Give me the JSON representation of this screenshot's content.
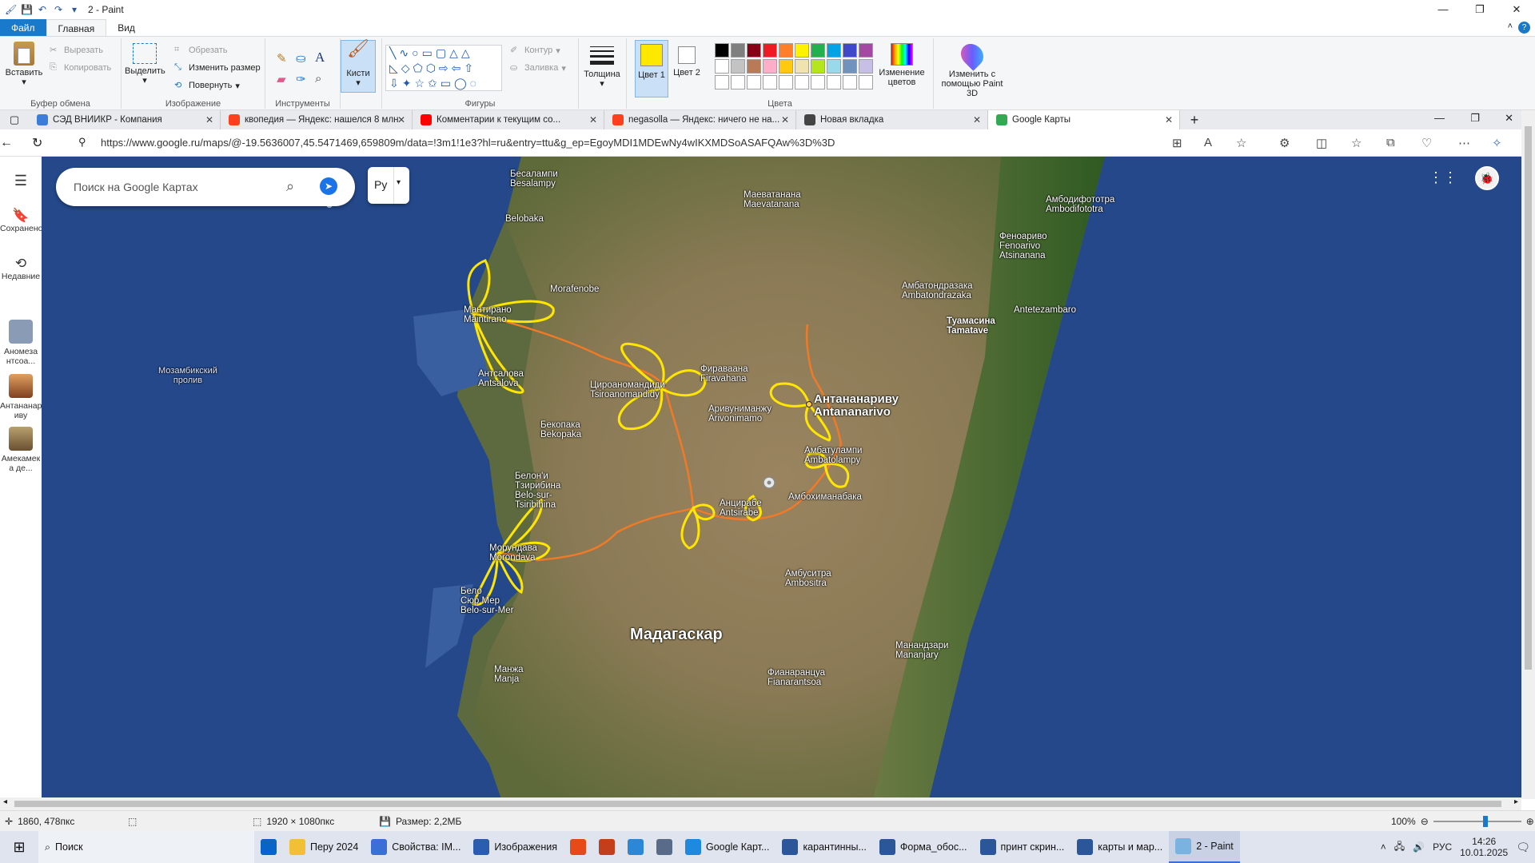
{
  "window": {
    "title": "2 - Paint",
    "controls": [
      "—",
      "❐",
      "✕"
    ]
  },
  "ribbon_tabs": [
    "Файл",
    "Главная",
    "Вид"
  ],
  "ribbon": {
    "clipboard": {
      "paste": "Вставить",
      "cut": "Вырезать",
      "copy": "Копировать",
      "label": "Буфер обмена"
    },
    "image": {
      "select": "Выделить",
      "crop": "Обрезать",
      "resize": "Изменить размер",
      "rotate": "Повернуть",
      "label": "Изображение"
    },
    "tools": {
      "label": "Инструменты"
    },
    "brushes": {
      "label": "Кисти"
    },
    "shapes": {
      "outline": "Контур",
      "fill": "Заливка",
      "label": "Фигуры"
    },
    "size": {
      "label": "Толщина"
    },
    "colors": {
      "color1": "Цвет 1",
      "color2": "Цвет 2",
      "edit": "Изменение цветов",
      "label": "Цвета",
      "color1_value": "#ffe800",
      "color2_value": "#ffffff",
      "palette_row1": [
        "#000000",
        "#7f7f7f",
        "#880015",
        "#ed1c24",
        "#ff7f27",
        "#fff200",
        "#22b14c",
        "#00a2e8",
        "#3f48cc",
        "#a349a4"
      ],
      "palette_row2": [
        "#ffffff",
        "#c3c3c3",
        "#b97a57",
        "#ffaec9",
        "#ffc90e",
        "#efe4b0",
        "#b5e61d",
        "#99d9ea",
        "#7092be",
        "#c8bfe7"
      ]
    },
    "paint3d": "Изменить с помощью Paint 3D"
  },
  "browser": {
    "tabs": [
      {
        "label": "СЭД ВНИИКР - Компания",
        "fav_color": "#3b7dd8"
      },
      {
        "label": "квопедия — Яндекс: нашелся 8 млн",
        "fav_color": "#fc3f1d"
      },
      {
        "label": "Комментарии к текущим со...",
        "fav_color": "#ff0000"
      },
      {
        "label": "negasolla — Яндекс: ничего не на...",
        "fav_color": "#fc3f1d"
      },
      {
        "label": "Новая вкладка",
        "fav_color": "#444444"
      },
      {
        "label": "Google Карты",
        "fav_color": "#34a853"
      }
    ],
    "url": "https://www.google.ru/maps/@-19.5636007,45.5471469,659809m/data=!3m1!1e3?hl=ru&entry=ttu&g_ep=EgoyMDI1MDEwNy4wIKXMDSoASAFQAw%3D%3D"
  },
  "maps": {
    "search_placeholder": "Поиск на Google Картах",
    "layer_label": "Ру",
    "rail": [
      {
        "label": "Сохранено"
      },
      {
        "label": "Недавние"
      },
      {
        "label": "Аномеза нтсоа..."
      },
      {
        "label": "Антананар иву"
      },
      {
        "label": "Амекамек а де..."
      }
    ],
    "labels": [
      {
        "text": "Бесалампи\nBesalampy",
        "cls": ""
      },
      {
        "text": "Маеватанана\nMaevatanana",
        "cls": ""
      },
      {
        "text": "Амбодифототра\nAmbodifototra",
        "cls": ""
      },
      {
        "text": "Belobaka",
        "cls": ""
      },
      {
        "text": "Феноариво\nFenoarivo\nAtsinanana",
        "cls": ""
      },
      {
        "text": "Morafenobe",
        "cls": ""
      },
      {
        "text": "Амбатондразака\nAmbatondrazaka",
        "cls": ""
      },
      {
        "text": "Мантирано\nMaintirano",
        "cls": ""
      },
      {
        "text": "Antetezambaro",
        "cls": ""
      },
      {
        "text": "Туамасина\nTamatave",
        "cls": "big-ish"
      },
      {
        "text": "Мозамбикский\nпролив",
        "cls": "sea"
      },
      {
        "text": "Антсалова\nAntsalova",
        "cls": ""
      },
      {
        "text": "Фираваана\nFiravahana",
        "cls": ""
      },
      {
        "text": "Цироаномандиди\nTsiroanomandidy",
        "cls": ""
      },
      {
        "text": "Антананариву\nAntananarivo",
        "cls": "big"
      },
      {
        "text": "Аривуниманжу\nArivonimamo",
        "cls": ""
      },
      {
        "text": "Бекопака\nBekopaka",
        "cls": ""
      },
      {
        "text": "Амбатулампи\nAmbatolampy",
        "cls": ""
      },
      {
        "text": "Белон'и\nТзирибина\nBelo-sur-\nTsiribihina",
        "cls": ""
      },
      {
        "text": "Анцирабе\nAntsirabe",
        "cls": ""
      },
      {
        "text": "Амбохиманабака",
        "cls": ""
      },
      {
        "text": "Морундава\nMorondava",
        "cls": ""
      },
      {
        "text": "Амбуситра\nAmbositra",
        "cls": ""
      },
      {
        "text": "Бело\nСюр Мер\nBelo-sur-Mer",
        "cls": ""
      },
      {
        "text": "Мадагаскар",
        "cls": "huge"
      },
      {
        "text": "Манандзари\nMananjary",
        "cls": ""
      },
      {
        "text": "Манжа\nManja",
        "cls": ""
      },
      {
        "text": "Фианаранцуа\nFianarantsoa",
        "cls": ""
      }
    ]
  },
  "status": {
    "cursor": "1860, 478пкс",
    "image_size": "1920 × 1080пкс",
    "file_size": "Размер: 2,2МБ",
    "zoom": "100%"
  },
  "taskbar": {
    "search": "Поиск",
    "apps": [
      {
        "label": "",
        "color": "#0a64c8"
      },
      {
        "label": "Перу 2024",
        "color": "#f2c037"
      },
      {
        "label": "Свойства: IM...",
        "color": "#3a6fd8"
      },
      {
        "label": "Изображения",
        "color": "#2a5db0"
      },
      {
        "label": "",
        "color": "#e64a19"
      },
      {
        "label": "",
        "color": "#c43e1c"
      },
      {
        "label": "",
        "color": "#2b88d8"
      },
      {
        "label": "",
        "color": "#5a6b8a"
      },
      {
        "label": "Google Карт...",
        "color": "#1d8ae0"
      },
      {
        "label": "карантинны...",
        "color": "#2b579a"
      },
      {
        "label": "Форма_обос...",
        "color": "#2b579a"
      },
      {
        "label": "принт скрин...",
        "color": "#2b579a"
      },
      {
        "label": "карты и мар...",
        "color": "#2b579a"
      },
      {
        "label": "2 - Paint",
        "color": "#7ab3e0"
      }
    ],
    "lang": "РУС",
    "time": "14:26",
    "date": "10.01.2025"
  }
}
